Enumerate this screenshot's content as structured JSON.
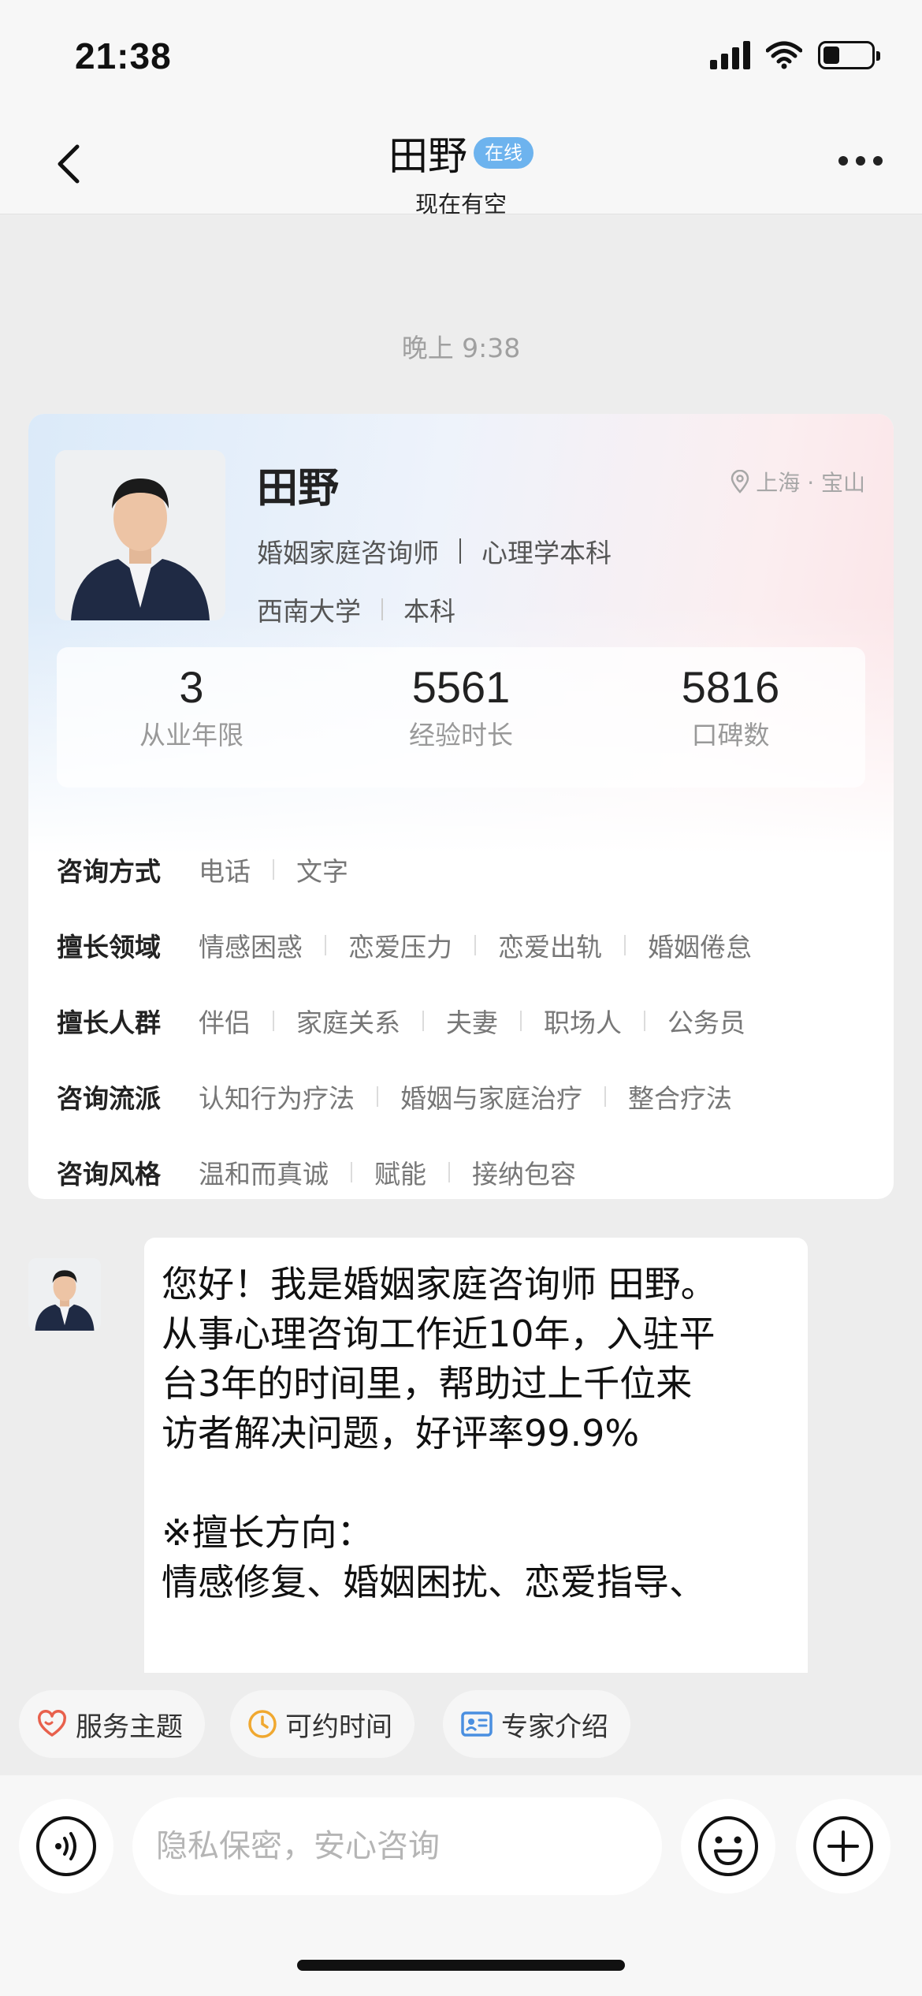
{
  "status_bar": {
    "time": "21:38",
    "battery_level": 0.35
  },
  "header": {
    "title": "田野",
    "badge": "在线",
    "subtitle": "现在有空"
  },
  "timestamp": "晚上 9:38",
  "profile": {
    "name": "田野",
    "location": "上海 · 宝山",
    "title": "婚姻家庭咨询师",
    "degree_major": "心理学本科",
    "school": "西南大学",
    "degree": "本科",
    "stats": [
      {
        "value": "3",
        "label": "从业年限"
      },
      {
        "value": "5561",
        "label": "经验时长"
      },
      {
        "value": "5816",
        "label": "口碑数"
      }
    ],
    "info": [
      {
        "label": "咨询方式",
        "values": [
          "电话",
          "文字"
        ]
      },
      {
        "label": "擅长领域",
        "values": [
          "情感困惑",
          "恋爱压力",
          "恋爱出轨",
          "婚姻倦怠"
        ]
      },
      {
        "label": "擅长人群",
        "values": [
          "伴侣",
          "家庭关系",
          "夫妻",
          "职场人",
          "公务员"
        ]
      },
      {
        "label": "咨询流派",
        "values": [
          "认知行为疗法",
          "婚姻与家庭治疗",
          "整合疗法"
        ]
      },
      {
        "label": "咨询风格",
        "values": [
          "温和而真诚",
          "赋能",
          "接纳包容"
        ]
      }
    ]
  },
  "message": {
    "lines": [
      "您好！我是婚姻家庭咨询师 田野。",
      "从事心理咨询工作近10年，入驻平",
      "台3年的时间里，帮助过上千位来",
      "访者解决问题，好评率99.9%",
      "",
      "※擅长方向：",
      "情感修复、婚姻困扰、恋爱指导、"
    ]
  },
  "chips": [
    {
      "label": "服务主题",
      "icon": "heart-icon",
      "color": "#e8604c"
    },
    {
      "label": "可约时间",
      "icon": "clock-icon",
      "color": "#f0a830"
    },
    {
      "label": "专家介绍",
      "icon": "id-card-icon",
      "color": "#4a8fe0"
    }
  ],
  "input": {
    "placeholder": "隐私保密，安心咨询"
  },
  "colors": {
    "badge": "#6db3ee",
    "background": "#ededed"
  }
}
